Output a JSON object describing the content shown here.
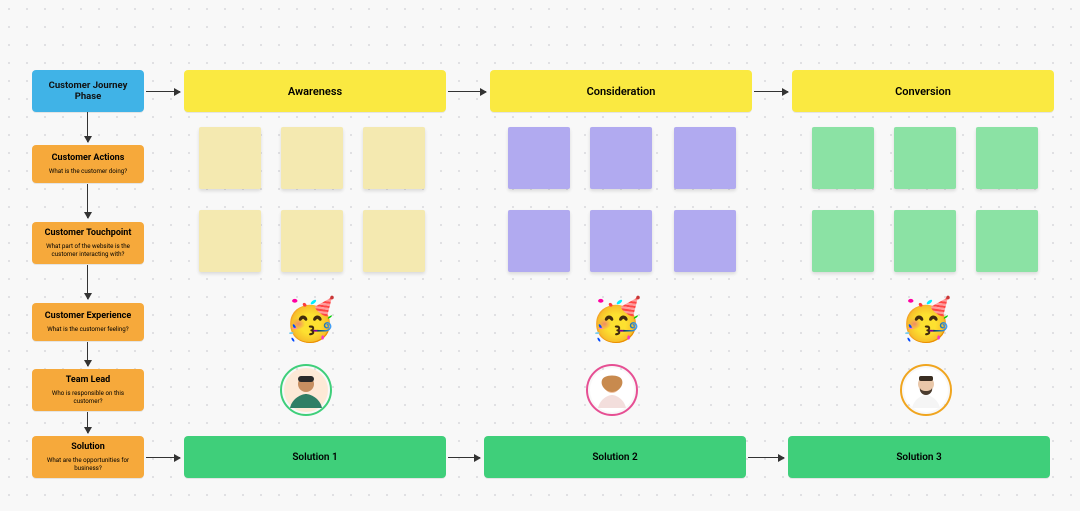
{
  "left": {
    "phase_title": "Customer Journey Phase",
    "actions_title": "Customer Actions",
    "actions_sub": "What is the customer doing?",
    "touch_title": "Customer Touchpoint",
    "touch_sub": "What part of the website is the customer interacting with?",
    "exp_title": "Customer Experience",
    "exp_sub": "What is the customer feeling?",
    "lead_title": "Team Lead",
    "lead_sub": "Who is responsible on this customer?",
    "sol_title": "Solution",
    "sol_sub": "What are the opportunities for business?"
  },
  "phases": {
    "p1": "Awareness",
    "p2": "Consideration",
    "p3": "Conversion"
  },
  "solutions": {
    "s1": "Solution 1",
    "s2": "Solution 2",
    "s3": "Solution 3"
  },
  "experience_emoji": "🥳",
  "note_colors": {
    "awareness": "yellow",
    "consideration": "purple",
    "conversion": "green"
  },
  "colors": {
    "phase_header": "#40b3e7",
    "row_header": "#f6a93b",
    "phase_bar": "#fae941",
    "solution_bar": "#3fcf7a"
  }
}
